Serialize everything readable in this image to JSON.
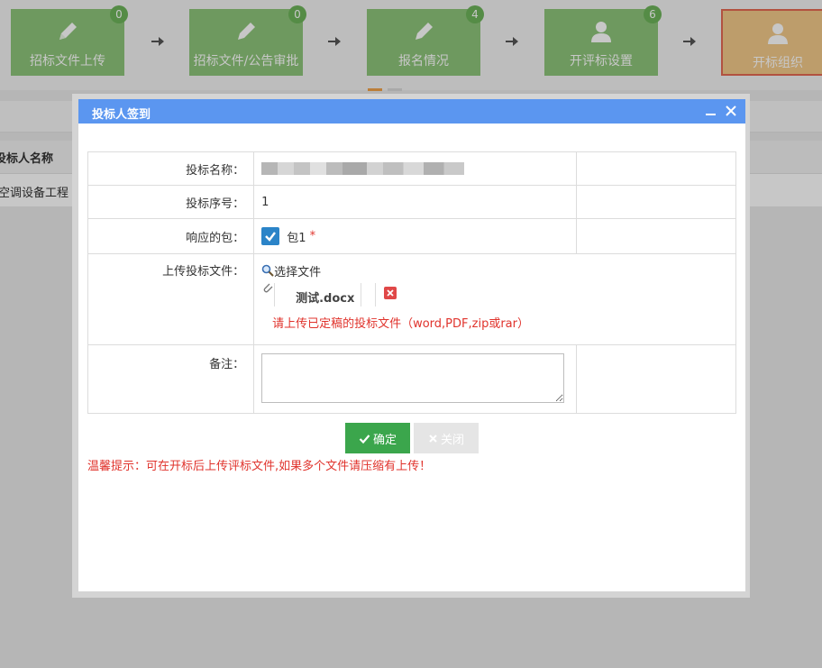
{
  "steps": [
    {
      "label": "招标文件上传",
      "badge": "0",
      "icon": "pencil-icon"
    },
    {
      "label": "招标文件/公告审批",
      "badge": "0",
      "icon": "pencil-icon"
    },
    {
      "label": "报名情况",
      "badge": "4",
      "icon": "pencil-icon"
    },
    {
      "label": "开评标设置",
      "badge": "6",
      "icon": "user-icon"
    },
    {
      "label": "开标组织",
      "badge": "",
      "icon": "user-icon"
    }
  ],
  "background_table": {
    "header": "投标人名称",
    "row": "空调设备工程"
  },
  "dialog": {
    "title": "投标人签到",
    "fields": {
      "name_label": "投标名称：",
      "seq_label": "投标序号：",
      "seq_value": "1",
      "package_label": "响应的包：",
      "package_value": "包1",
      "required_mark": "*",
      "upload_label": "上传投标文件：",
      "upload_button": "选择文件",
      "file_name": "测试.docx",
      "upload_hint": "请上传已定稿的投标文件（word,PDF,zip或rar）",
      "memo_label": "备注：",
      "memo_value": ""
    },
    "buttons": {
      "ok": "确定",
      "close": "关闭"
    },
    "tip": "温馨提示：可在开标后上传评标文件,如果多个文件请压缩有上传！"
  },
  "colors": {
    "step_green": "#8ec57a",
    "step_active": "#f2c98a",
    "dialog_header": "#5b96f0",
    "ok_button": "#3ba64c",
    "alert_red": "#e0332c"
  }
}
